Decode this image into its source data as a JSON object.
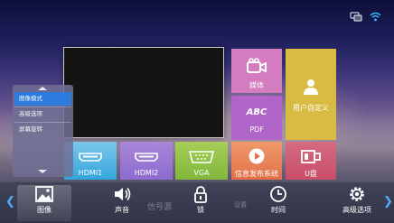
{
  "status": {
    "icons": [
      "network-icon",
      "wifi-icon"
    ]
  },
  "main": {
    "tiles": {
      "media": "媒体",
      "pdf": "PDF",
      "pdf_glyph": "ABC",
      "custom": "用户自定义",
      "hdmi1": "HDMI1",
      "hdmi2": "HDMI2",
      "vga": "VGA",
      "signage": "信息发布系统",
      "udisk": "U盘"
    }
  },
  "popup": {
    "items": [
      "图像模式",
      "高级选项",
      "屏幕旋转"
    ],
    "selected_index": 0
  },
  "dock": {
    "items": [
      "图像",
      "声音",
      "锁",
      "时间",
      "高级选项"
    ],
    "ghost_labels": [
      "信号源",
      "设置"
    ],
    "selected_index": 0
  },
  "colors": {
    "media": "#d37cc0",
    "pdf": "#b265c9",
    "custom": "#d9ba42",
    "hdmi1": "#34a4dc",
    "hdmi2": "#8d6bd0",
    "vga": "#81b63d",
    "signage": "#e36f47",
    "udisk": "#c94d68",
    "selection": "#2d7bdc"
  }
}
